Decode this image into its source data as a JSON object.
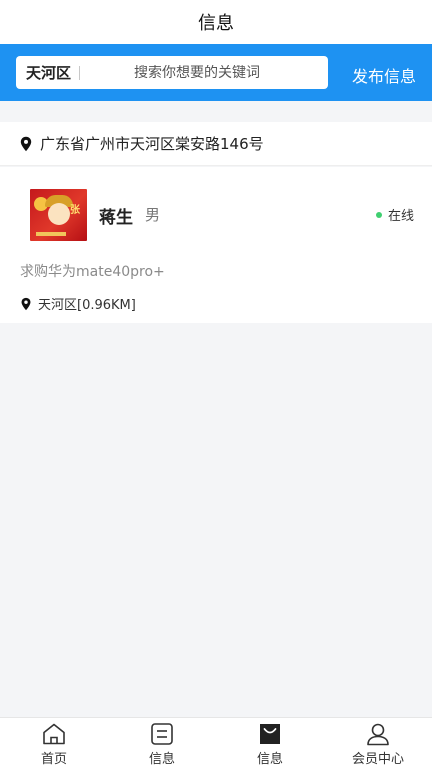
{
  "header": {
    "title": "信息"
  },
  "search": {
    "district": "天河区",
    "placeholder": "搜索你想要的关键词",
    "publish_label": "发布信息"
  },
  "location": {
    "address": "广东省广州市天河区棠安路146号"
  },
  "posts": [
    {
      "name": "蒋生",
      "gender": "男",
      "status": "在线",
      "text": "求购华为mate40pro+",
      "location": "天河区[0.96KM]",
      "avatar_text": "张"
    }
  ],
  "tabbar": {
    "items": [
      {
        "label": "首页",
        "icon": "home-icon"
      },
      {
        "label": "信息",
        "icon": "message-icon"
      },
      {
        "label": "信息",
        "icon": "bag-icon",
        "active": true
      },
      {
        "label": "会员中心",
        "icon": "user-icon"
      }
    ]
  },
  "colors": {
    "accent": "#1e92f2",
    "online": "#3fcf70"
  }
}
